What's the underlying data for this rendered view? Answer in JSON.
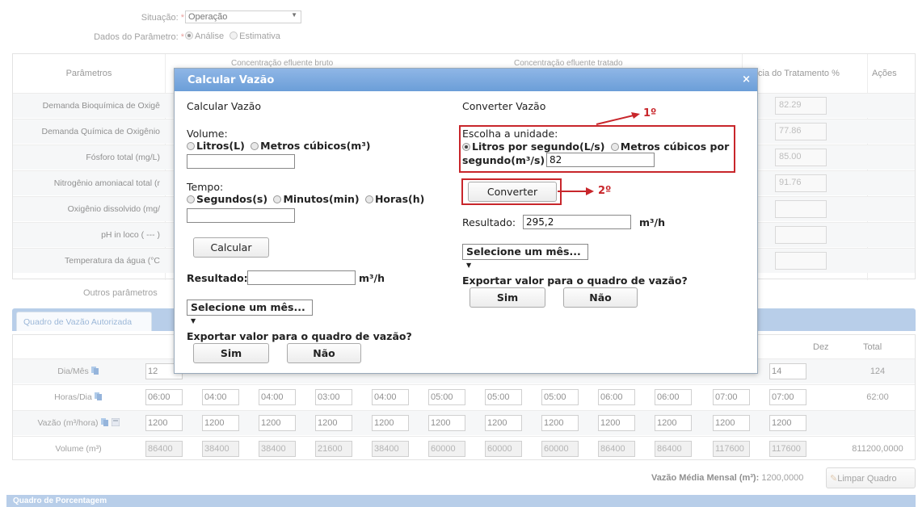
{
  "form": {
    "situacao_label": "Situação:",
    "situacao_value": "Operação",
    "dados_label": "Dados do Parâmetro:",
    "req_mark": "*",
    "opt_analise": "Análise",
    "opt_estimativa": "Estimativa"
  },
  "param_table": {
    "col_parametros": "Parâmetros",
    "col_bruto": "Concentração efluente bruto",
    "col_tratado": "Concentração efluente tratado",
    "col_eficiencia": "cia do Tratamento %",
    "col_acoes": "Ações",
    "rows": [
      {
        "name": "Demanda Bioquímica de Oxigê",
        "eff": "82.29"
      },
      {
        "name": "Demanda Química de Oxigênio",
        "eff": "77.86"
      },
      {
        "name": "Fósforo total (mg/L)",
        "eff": "85.00"
      },
      {
        "name": "Nitrogênio amoniacal total (r",
        "eff": "91.76"
      },
      {
        "name": "Oxigênio dissolvido (mg/",
        "eff": ""
      },
      {
        "name": "pH in loco ( --- )",
        "eff": ""
      },
      {
        "name": "Temperatura da água (°C",
        "eff": ""
      }
    ],
    "outros": "Outros parâmetros"
  },
  "tabs": {
    "active": "Quadro de Vazão Autorizada"
  },
  "flow_table": {
    "head_dez": "Dez",
    "head_total": "Total",
    "rows": [
      {
        "label": "Dia/Mês",
        "values": [
          "12",
          "",
          "",
          "",
          "",
          "",
          "",
          "",
          "",
          "",
          "",
          "14"
        ],
        "total": "124"
      },
      {
        "label": "Horas/Dia",
        "values": [
          "06:00",
          "04:00",
          "04:00",
          "03:00",
          "04:00",
          "05:00",
          "05:00",
          "05:00",
          "06:00",
          "06:00",
          "07:00",
          "07:00"
        ],
        "total": "62:00"
      },
      {
        "label": "Vazão (m³/hora)",
        "values": [
          "1200",
          "1200",
          "1200",
          "1200",
          "1200",
          "1200",
          "1200",
          "1200",
          "1200",
          "1200",
          "1200",
          "1200"
        ],
        "total": ""
      },
      {
        "label": "Volume (m³)",
        "values": [
          "86400",
          "38400",
          "38400",
          "21600",
          "38400",
          "60000",
          "60000",
          "60000",
          "86400",
          "86400",
          "117600",
          "117600"
        ],
        "total": "811200,0000"
      }
    ]
  },
  "bottom": {
    "mean_label": "Vazão Média Mensal (m³):",
    "mean_value": "1200,0000",
    "clear_button": "Limpar Quadro",
    "pct_title": "Quadro de Porcentagem"
  },
  "modal": {
    "title": "Calcular Vazão",
    "close": "×",
    "left": {
      "heading": "Calcular Vazão",
      "volume_label": "Volume:",
      "opt_litros": "Litros(L)",
      "opt_metros": "Metros cúbicos(m³)",
      "volume_value": "",
      "tempo_label": "Tempo:",
      "opt_seg": "Segundos(s)",
      "opt_min": "Minutos(min)",
      "opt_horas": "Horas(h)",
      "tempo_value": "",
      "calc_button": "Calcular",
      "resultado_label": "Resultado:",
      "resultado_value": "",
      "unit": "m³/h",
      "month_select": "Selecione um mês...",
      "export_q": "Exportar valor para o quadro de vazão?",
      "yes": "Sim",
      "no": "Não"
    },
    "right": {
      "heading": "Converter Vazão",
      "unit_label": "Escolha a unidade:",
      "opt_lps": "Litros por segundo(L/s)",
      "opt_m3s_a": "Metros cúbicos por",
      "opt_m3s_b": "segundo(m³/s)",
      "input_value": "82",
      "convert_button": "Converter",
      "resultado_label": "Resultado:",
      "resultado_value": "295,2",
      "unit": "m³/h",
      "month_select": "Selecione um mês...",
      "export_q": "Exportar valor para o quadro de vazão?",
      "yes": "Sim",
      "no": "Não"
    }
  },
  "annotations": {
    "first": "1º",
    "second": "2º",
    "color": "#c8262b"
  }
}
